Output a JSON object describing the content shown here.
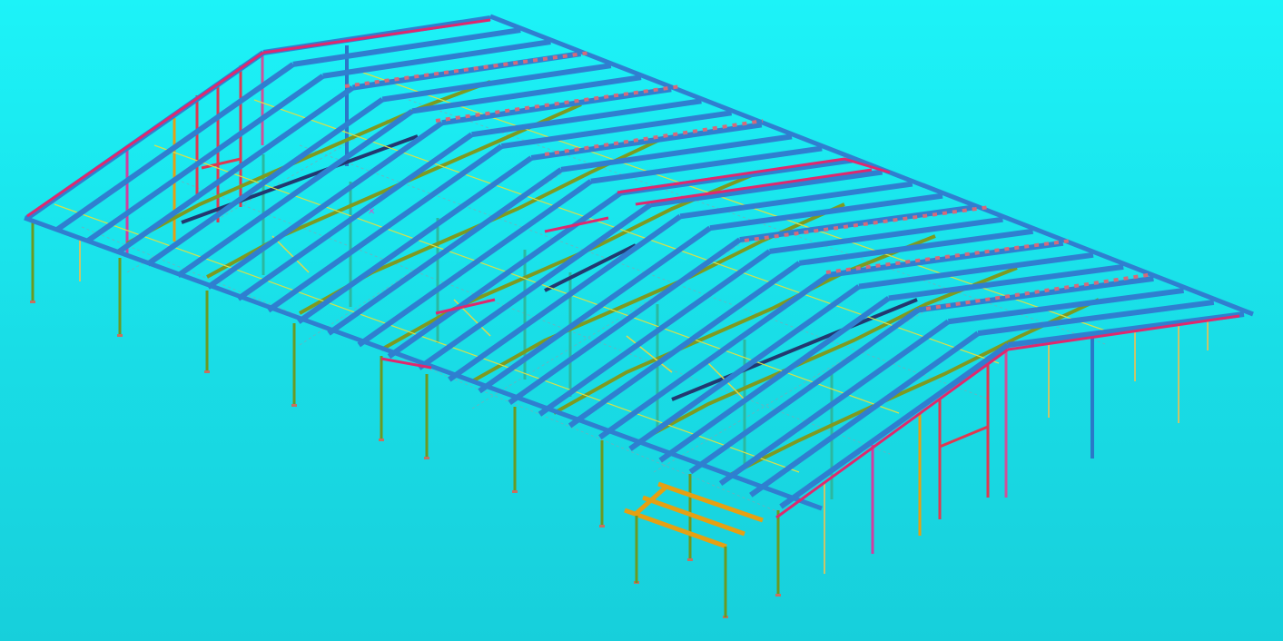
{
  "viewport": {
    "background_top": "#1cf3f8",
    "background_bottom": "#17cfdb"
  },
  "model": {
    "description_label": "",
    "colors": {
      "purlin": "#2f7fd0",
      "rafter": "#e0286e",
      "truss": "#7f9a1f",
      "truss_dark": "#223870",
      "tie": "#d8e048",
      "column": "#6a9a22",
      "column_teal": "#2bb8a0",
      "column_pink": "#d0509a",
      "column_orange": "#e6a012",
      "column_red": "#e03850"
    }
  }
}
